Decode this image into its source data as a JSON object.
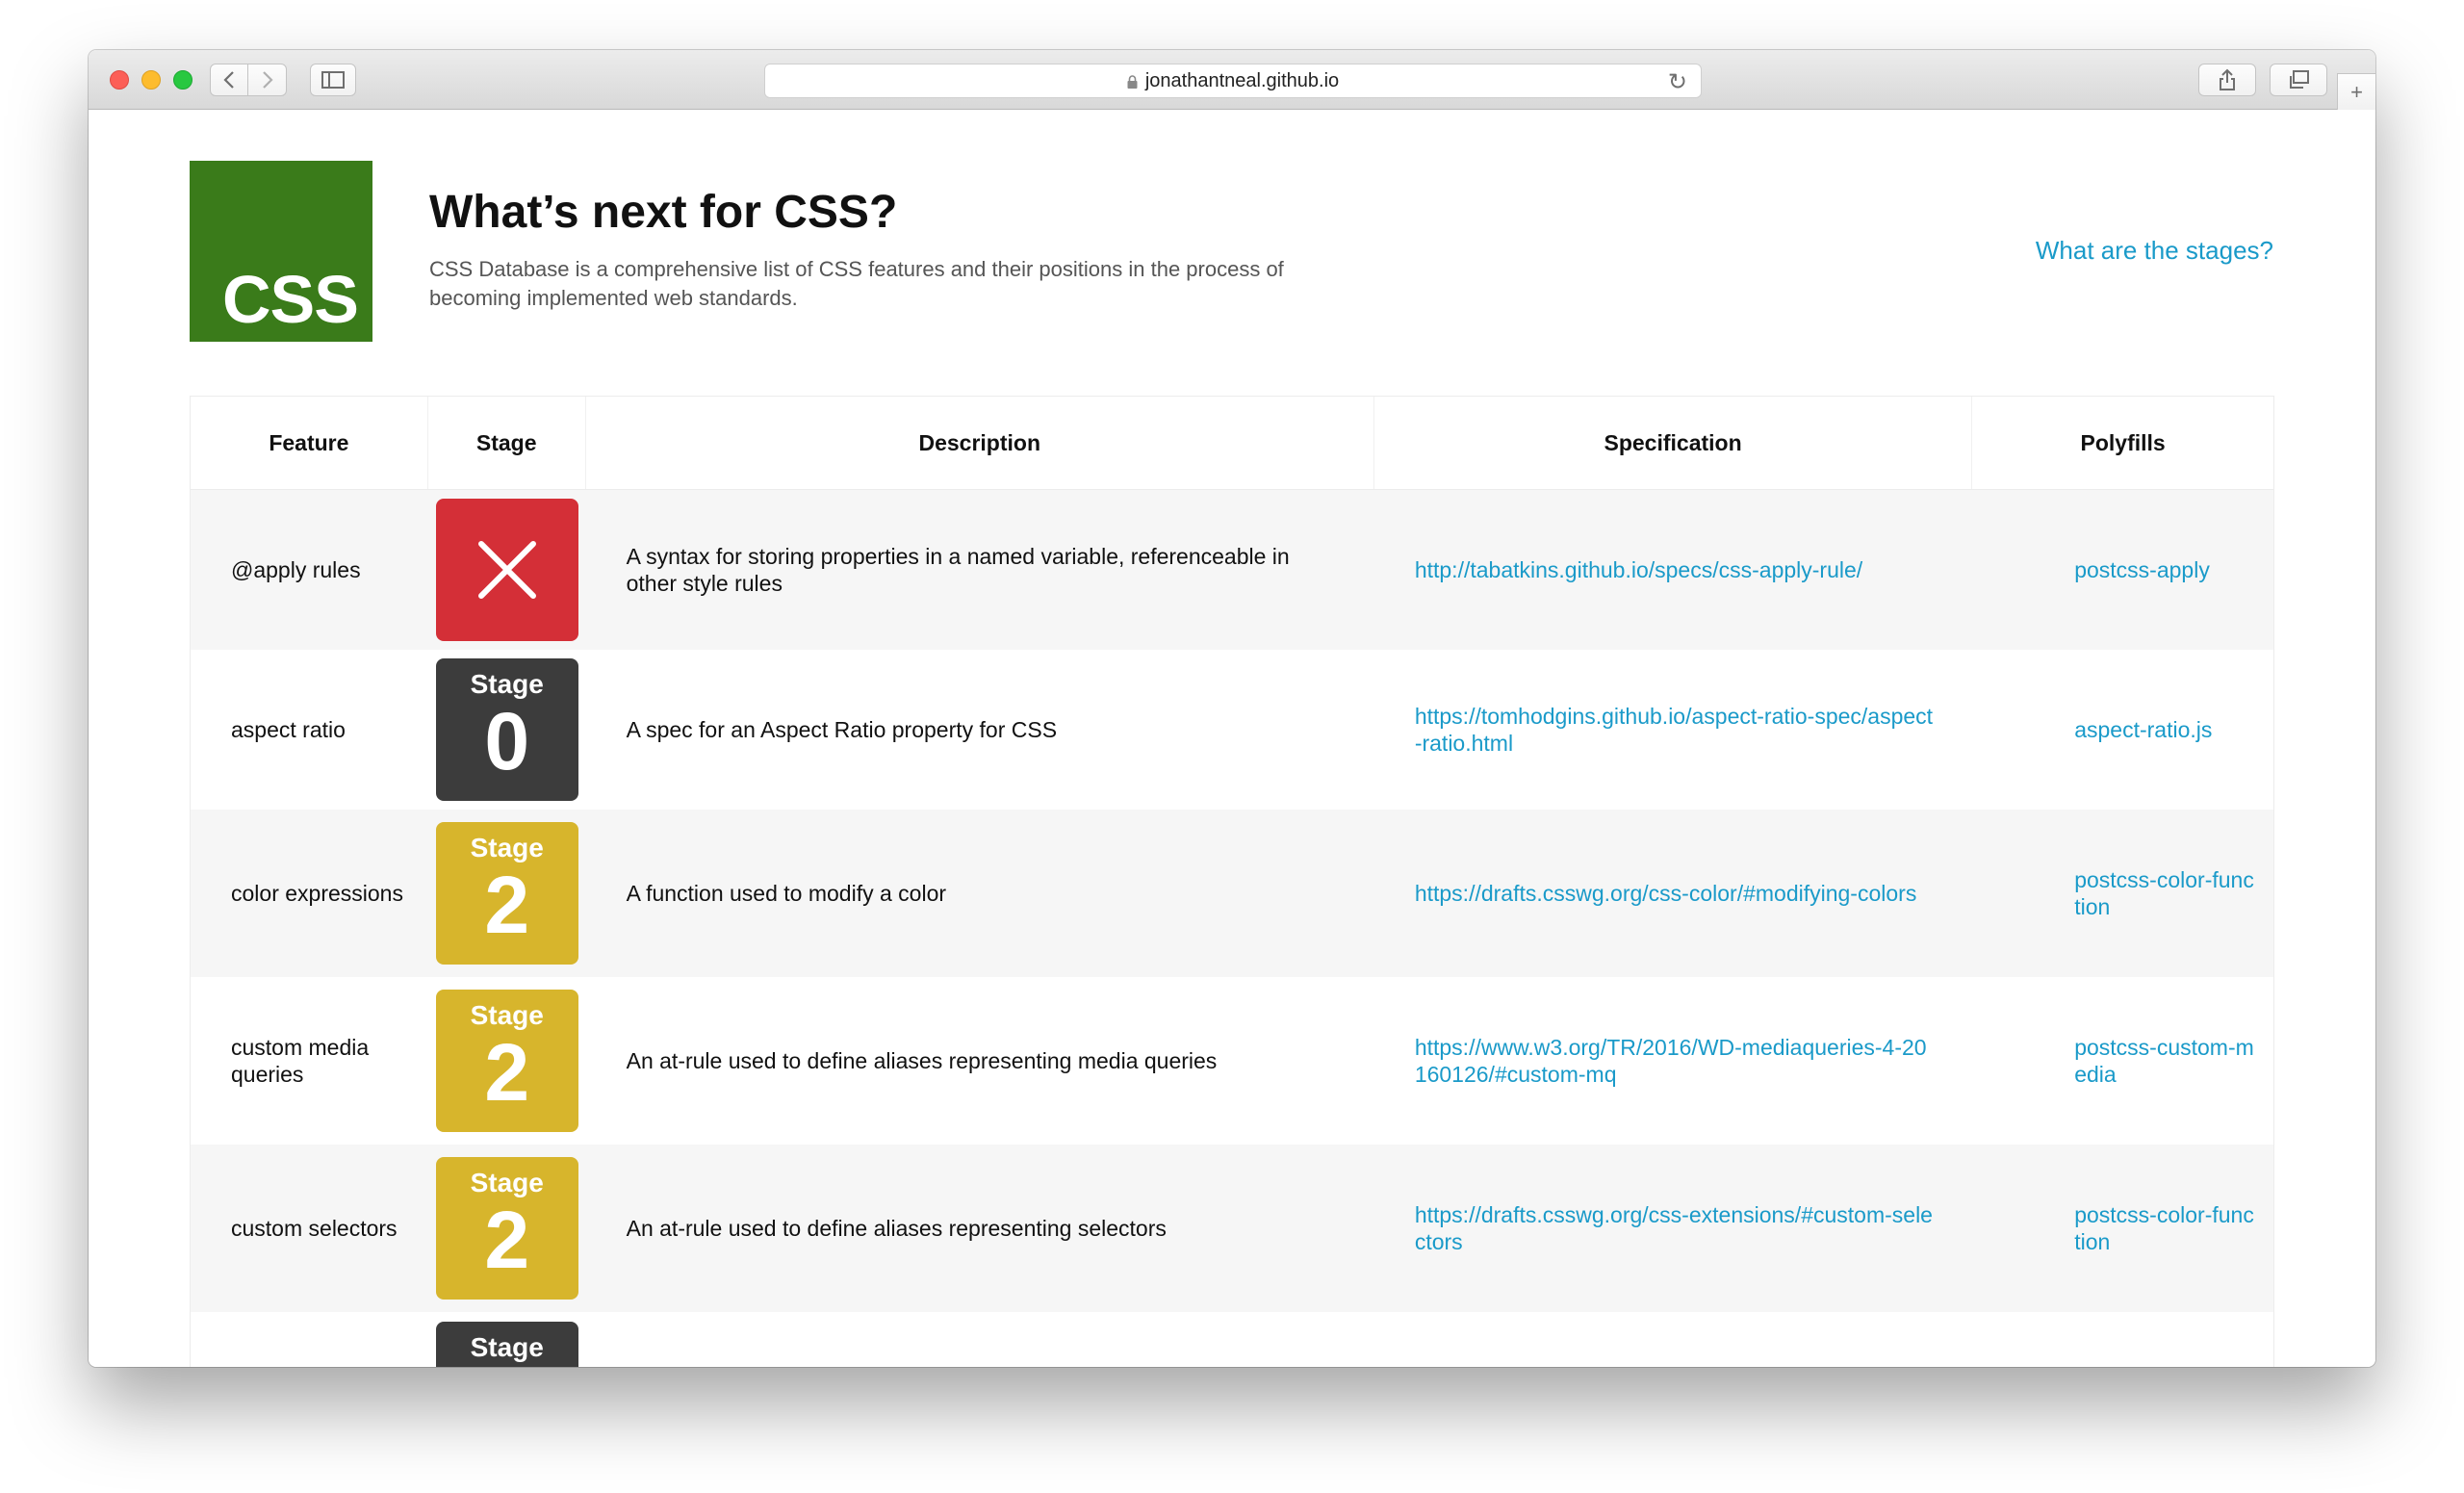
{
  "browser": {
    "url": "jonathantneal.github.io",
    "icons": [
      "back-icon",
      "forward-icon",
      "sidebar-icon",
      "lock-icon",
      "reload-icon",
      "share-icon",
      "tabs-icon",
      "new-tab-icon"
    ]
  },
  "header": {
    "logo_text": "CSS",
    "title": "What’s next for CSS?",
    "subtitle": "CSS Database is a comprehensive list of CSS features and their positions in the process of becoming implemented web standards.",
    "stages_link": "What are the stages?"
  },
  "table": {
    "columns": [
      "Feature",
      "Stage",
      "Description",
      "Specification",
      "Polyfills"
    ],
    "rows": [
      {
        "feature": "@apply rules",
        "stage": "rejected",
        "stage_label": "",
        "stage_number": "",
        "description": "A syntax for storing properties in a named variable, referenceable in other style rules",
        "specification": "http://tabatkins.github.io/specs/css-apply-rule/",
        "polyfill": "postcss-apply"
      },
      {
        "feature": "aspect ratio",
        "stage": "s0",
        "stage_label": "Stage",
        "stage_number": "0",
        "description": "A spec for an Aspect Ratio property for CSS",
        "specification": "https://tomhodgins.github.io/aspect-ratio-spec/aspect-ratio.html",
        "polyfill": "aspect-ratio.js"
      },
      {
        "feature": "color expressions",
        "stage": "s2",
        "stage_label": "Stage",
        "stage_number": "2",
        "description": "A function used to modify a color",
        "specification": "https://drafts.csswg.org/css-color/#modifying-colors",
        "polyfill": "postcss-color-function"
      },
      {
        "feature": "custom media queries",
        "stage": "s2",
        "stage_label": "Stage",
        "stage_number": "2",
        "description": "An at-rule used to define aliases representing media queries",
        "specification": "https://www.w3.org/TR/2016/WD-mediaqueries-4-20160126/#custom-mq",
        "polyfill": "postcss-custom-media"
      },
      {
        "feature": "custom selectors",
        "stage": "s2",
        "stage_label": "Stage",
        "stage_number": "2",
        "description": "An at-rule used to define aliases representing selectors",
        "specification": "https://drafts.csswg.org/css-extensions/#custom-selectors",
        "polyfill": "postcss-color-function"
      },
      {
        "feature": "",
        "stage": "s0",
        "stage_label": "Stage",
        "stage_number": "",
        "description": "",
        "specification": "",
        "polyfill": ""
      }
    ]
  },
  "colors": {
    "logo": "#3a7b1a",
    "link": "#1a9ac9",
    "rejected": "#d42f37",
    "stage0": "#3c3c3c",
    "stage2": "#d7b52c"
  }
}
